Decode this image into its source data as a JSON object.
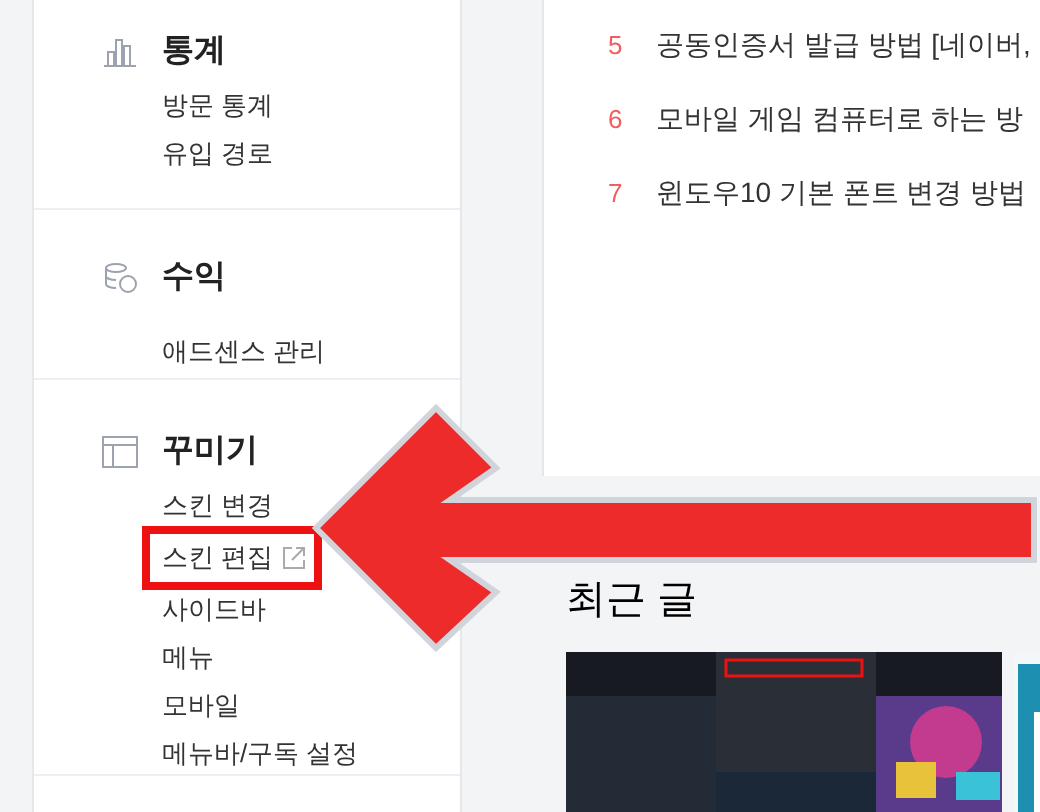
{
  "sidebar": {
    "sections": [
      {
        "kind": "stats",
        "title": "통계",
        "items": [
          {
            "label": "방문 통계",
            "external": false,
            "highlighted": false
          },
          {
            "label": "유입 경로",
            "external": false,
            "highlighted": false
          }
        ]
      },
      {
        "kind": "revenue",
        "title": "수익",
        "items": [
          {
            "label": "애드센스 관리",
            "external": false,
            "highlighted": false
          }
        ]
      },
      {
        "kind": "design",
        "title": "꾸미기",
        "items": [
          {
            "label": "스킨 변경",
            "external": false,
            "highlighted": false
          },
          {
            "label": "스킨 편집",
            "external": true,
            "highlighted": true
          },
          {
            "label": "사이드바",
            "external": false,
            "highlighted": false
          },
          {
            "label": "메뉴",
            "external": false,
            "highlighted": false
          },
          {
            "label": "모바일",
            "external": false,
            "highlighted": false
          },
          {
            "label": "메뉴바/구독 설정",
            "external": false,
            "highlighted": false
          }
        ]
      }
    ]
  },
  "popular_posts": [
    {
      "rank": "5",
      "title": "공동인증서 발급 방법 [네이버,"
    },
    {
      "rank": "6",
      "title": "모바일 게임 컴퓨터로 하는 방"
    },
    {
      "rank": "7",
      "title": "윈도우10 기본 폰트 변경 방법"
    }
  ],
  "recent_posts": {
    "title": "최근 글"
  }
}
